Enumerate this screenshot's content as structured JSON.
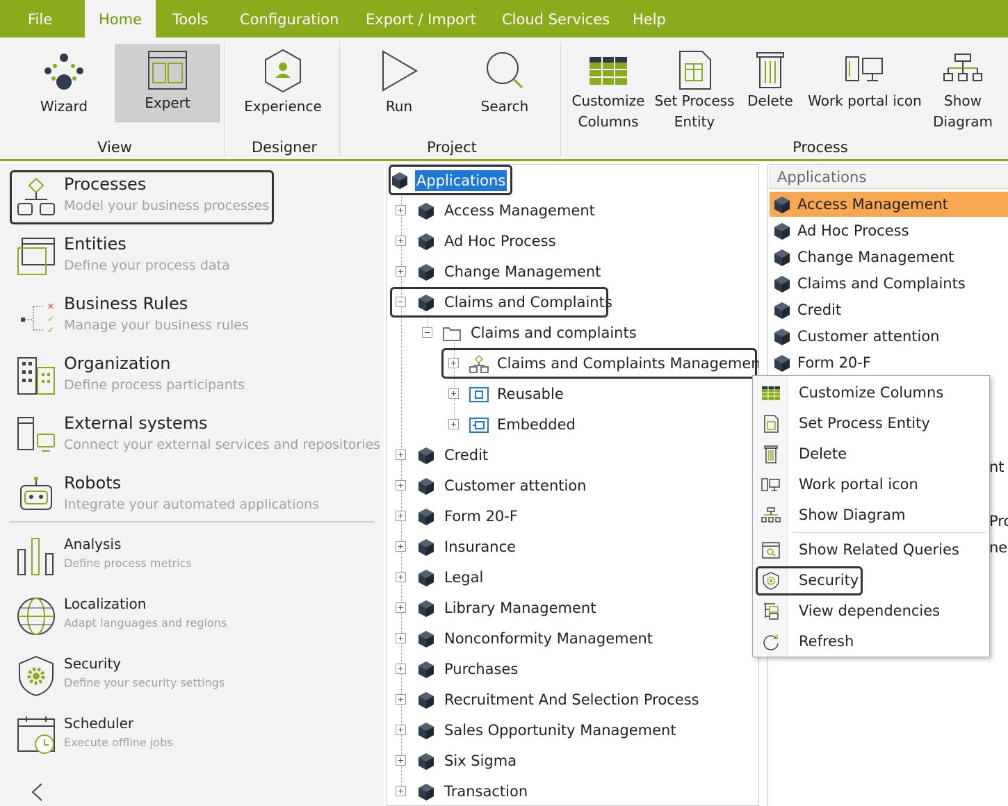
{
  "menu": {
    "items": [
      "File",
      "Home",
      "Tools",
      "Configuration",
      "Export / Import",
      "Cloud Services",
      "Help"
    ],
    "active": "Home"
  },
  "ribbon": {
    "view": {
      "label": "View",
      "wizard": "Wizard",
      "expert": "Expert"
    },
    "designer": {
      "label": "Designer",
      "experience": "Experience"
    },
    "project": {
      "label": "Project",
      "run": "Run",
      "search": "Search"
    },
    "process": {
      "label": "Process",
      "customize_l1": "Customize",
      "customize_l2": "Columns",
      "setentity_l1": "Set Process",
      "setentity_l2": "Entity",
      "delete": "Delete",
      "workportal": "Work portal icon",
      "showdiagram_l1": "Show",
      "showdiagram_l2": "Diagram"
    }
  },
  "modules": [
    {
      "title": "Processes",
      "desc": "Model your business processes"
    },
    {
      "title": "Entities",
      "desc": "Define your process data"
    },
    {
      "title": "Business Rules",
      "desc": "Manage your business rules"
    },
    {
      "title": "Organization",
      "desc": "Define process participants"
    },
    {
      "title": "External systems",
      "desc": "Connect your external services and repositories"
    },
    {
      "title": "Robots",
      "desc": "Integrate your automated applications"
    },
    {
      "title": "Analysis",
      "desc": "Define process metrics"
    },
    {
      "title": "Localization",
      "desc": "Adapt languages and regions"
    },
    {
      "title": "Security",
      "desc": "Define your security settings"
    },
    {
      "title": "Scheduler",
      "desc": "Execute offline jobs"
    }
  ],
  "tree": {
    "root": "Applications",
    "apps": [
      "Access Management",
      "Ad Hoc Process",
      "Change Management",
      "Claims and Complaints",
      "Credit",
      "Customer attention",
      "Form 20-F",
      "Insurance",
      "Legal",
      "Library Management",
      "Nonconformity Management",
      "Purchases",
      "Recruitment And Selection Process",
      "Sales Opportunity Management",
      "Six Sigma",
      "Transaction"
    ],
    "folder": "Claims and complaints",
    "process": "Claims and Complaints Management",
    "reusable": "Reusable",
    "embedded": "Embedded"
  },
  "list": {
    "header": "Applications",
    "items": [
      "Access Management",
      "Ad Hoc Process",
      "Change Management",
      "Claims and Complaints",
      "Credit",
      "Customer attention",
      "Form 20-F"
    ],
    "selected_index": 0,
    "partial": {
      "a": "nt",
      "b": "Pro",
      "c": "nei"
    }
  },
  "context_menu": {
    "items": [
      "Customize Columns",
      "Set Process Entity",
      "Delete",
      "Work portal icon",
      "Show Diagram",
      "Show Related Queries",
      "Security",
      "View dependencies",
      "Refresh"
    ]
  },
  "colors": {
    "brand": "#8aab1b",
    "selection": "#1e78d7",
    "list_selected": "#f7a850",
    "hex_icon": "#2f3a4a"
  }
}
